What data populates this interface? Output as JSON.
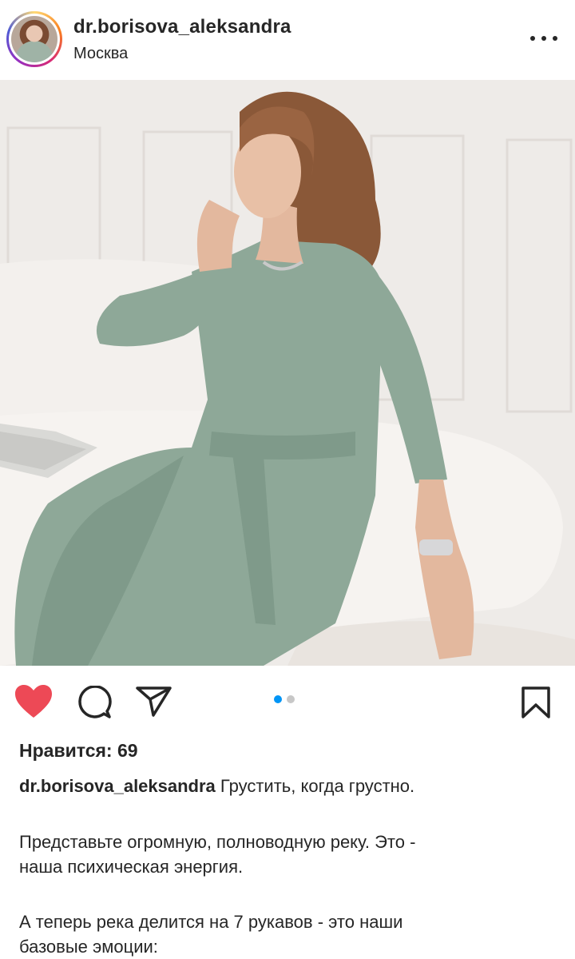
{
  "header": {
    "username": "dr.borisova_aleksandra",
    "location": "Москва",
    "avatar_icon": "profile-avatar",
    "more_icon": "more-options-icon"
  },
  "photo": {
    "description_icon": "post-photo"
  },
  "actions": {
    "like_icon": "heart-filled-icon",
    "like_color": "#ed4956",
    "comment_icon": "comment-icon",
    "share_icon": "share-icon",
    "save_icon": "bookmark-icon",
    "carousel": {
      "count": 2,
      "active_index": 0,
      "active_color": "#0095f6",
      "inactive_color": "#c7c7c7"
    }
  },
  "likes": {
    "text": "Нравится: 69"
  },
  "caption": {
    "username": "dr.borisova_aleksandra",
    "text": "Грустить, когда грустно."
  },
  "paragraphs": [
    "Представьте огромную, полноводную реку. Это -\nнаша психическая энергия.",
    "А теперь река делится на 7 рукавов - это наши\nбазовые эмоции:"
  ]
}
